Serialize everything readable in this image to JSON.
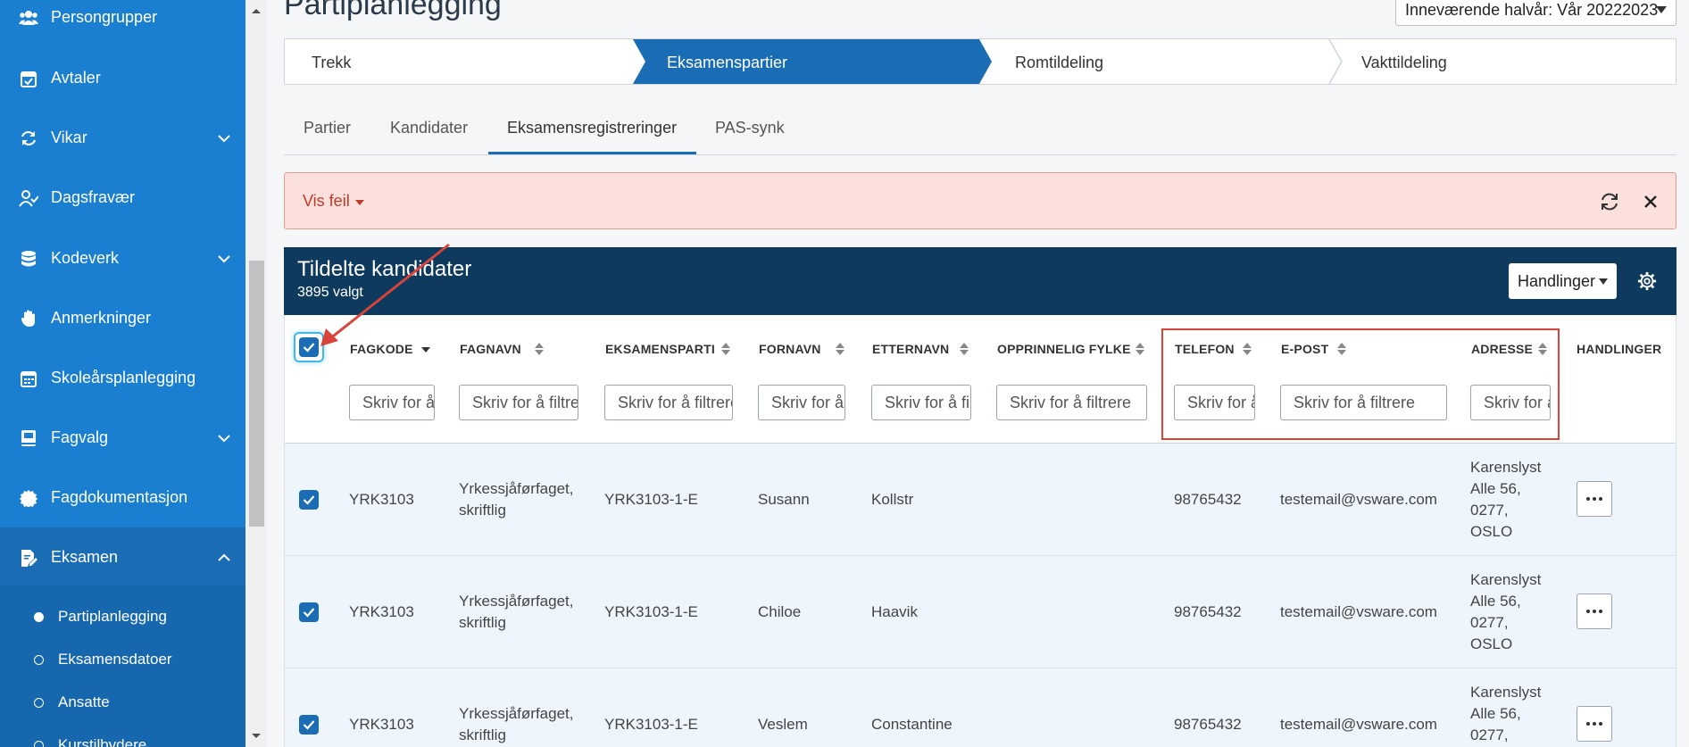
{
  "sidebar": {
    "items": [
      {
        "label": "Persongrupper",
        "icon": "users-icon"
      },
      {
        "label": "Avtaler",
        "icon": "calendar-check-icon"
      },
      {
        "label": "Vikar",
        "icon": "refresh-icon"
      },
      {
        "label": "Dagsfravær",
        "icon": "user-check-icon"
      },
      {
        "label": "Kodeverk",
        "icon": "database-icon"
      },
      {
        "label": "Anmerkninger",
        "icon": "hand-icon"
      },
      {
        "label": "Skoleårsplanlegging",
        "icon": "calendar-grid-icon"
      },
      {
        "label": "Fagvalg",
        "icon": "book-icon"
      },
      {
        "label": "Fagdokumentasjon",
        "icon": "badge-icon"
      },
      {
        "label": "Eksamen",
        "icon": "edit-doc-icon"
      }
    ],
    "sub_items": [
      {
        "label": "Partiplanlegging"
      },
      {
        "label": "Eksamensdatoer"
      },
      {
        "label": "Ansatte"
      },
      {
        "label": "Kurstilbydere"
      }
    ]
  },
  "header": {
    "title": "Partiplanlegging",
    "semester": "Inneværende halvår: Vår 20222023"
  },
  "stepper": {
    "steps": [
      "Trekk",
      "Eksamenspartier",
      "Romtildeling",
      "Vakttildeling"
    ]
  },
  "tabs": [
    "Partier",
    "Kandidater",
    "Eksamensregistreringer",
    "PAS-synk"
  ],
  "alert": {
    "toggle_label": "Vis feil"
  },
  "panel": {
    "title": "Tildelte kandidater",
    "subtitle": "3895 valgt",
    "actions_label": "Handlinger"
  },
  "table": {
    "columns": [
      {
        "label": "FAGKODE",
        "placeholder": "Skriv for å filtrere"
      },
      {
        "label": "FAGNAVN",
        "placeholder": "Skriv for å filtrere"
      },
      {
        "label": "EKSAMENSPARTI",
        "placeholder": "Skriv for å filtrere"
      },
      {
        "label": "FORNAVN",
        "placeholder": "Skriv for å filtrere"
      },
      {
        "label": "ETTERNAVN",
        "placeholder": "Skriv for å filtrere"
      },
      {
        "label": "OPPRINNELIG FYLKE",
        "placeholder": "Skriv for å filtrere"
      },
      {
        "label": "TELEFON",
        "placeholder": "Skriv for å filtrere"
      },
      {
        "label": "E-POST",
        "placeholder": "Skriv for å filtrere"
      },
      {
        "label": "ADRESSE",
        "placeholder": "Skriv for å filtrere"
      },
      {
        "label": "HANDLINGER"
      }
    ],
    "rows": [
      {
        "fagkode": "YRK3103",
        "fagnavn1": "Yrkessjåførfaget,",
        "fagnavn2": "skriftlig",
        "parti": "YRK3103-1-E",
        "fornavn": "Susann",
        "etternavn": "Kollstr",
        "fylke": "",
        "telefon": "98765432",
        "epost": "testemail@vsware.com",
        "adr1": "Karenslyst",
        "adr2": "Alle 56,",
        "adr3": "0277,",
        "adr4": "OSLO"
      },
      {
        "fagkode": "YRK3103",
        "fagnavn1": "Yrkessjåførfaget,",
        "fagnavn2": "skriftlig",
        "parti": "YRK3103-1-E",
        "fornavn": "Chiloe",
        "etternavn": "Haavik",
        "fylke": "",
        "telefon": "98765432",
        "epost": "testemail@vsware.com",
        "adr1": "Karenslyst",
        "adr2": "Alle 56,",
        "adr3": "0277,",
        "adr4": "OSLO"
      },
      {
        "fagkode": "YRK3103",
        "fagnavn1": "Yrkessjåførfaget,",
        "fagnavn2": "skriftlig",
        "parti": "YRK3103-1-E",
        "fornavn": "Veslem",
        "etternavn": "Constantine",
        "fylke": "",
        "telefon": "98765432",
        "epost": "testemail@vsware.com",
        "adr1": "Karenslyst",
        "adr2": "Alle 56,",
        "adr3": "0277,",
        "adr4": ""
      }
    ]
  },
  "colors": {
    "sidebar": "#1b7fd1",
    "primary": "#1a6db5",
    "panel_header": "#0e3a5e",
    "alert_bg": "#fbe0dc",
    "highlight": "#d9443a"
  }
}
